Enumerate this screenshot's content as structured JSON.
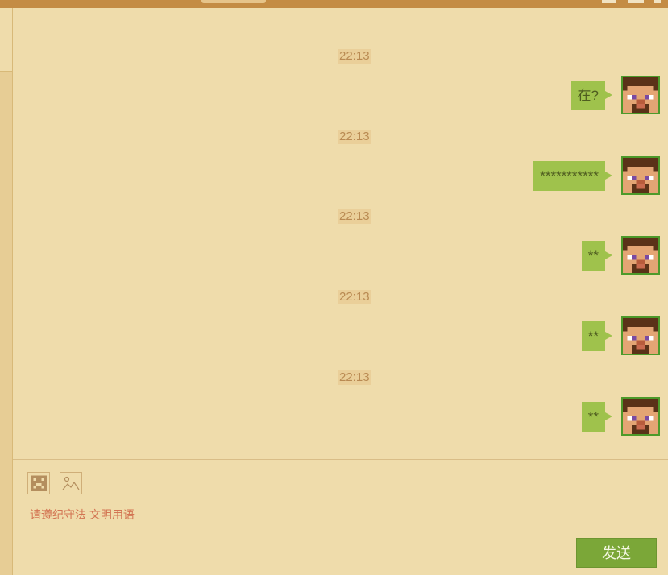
{
  "messages": [
    {
      "time": "22:13",
      "text": "在?"
    },
    {
      "time": "22:13",
      "text": "***********"
    },
    {
      "time": "22:13",
      "text": "**"
    },
    {
      "time": "22:13",
      "text": "**"
    },
    {
      "time": "22:13",
      "text": "**"
    }
  ],
  "toolbar": {
    "emoji_icon": "creeper-face-icon",
    "image_icon": "image-icon"
  },
  "composer": {
    "notice": "请遵纪守法 文明用语",
    "send_label": "发送"
  },
  "colors": {
    "bubble": "#9fc24c",
    "send": "#7ba738",
    "background": "#efdcab",
    "notice": "#d37553"
  }
}
